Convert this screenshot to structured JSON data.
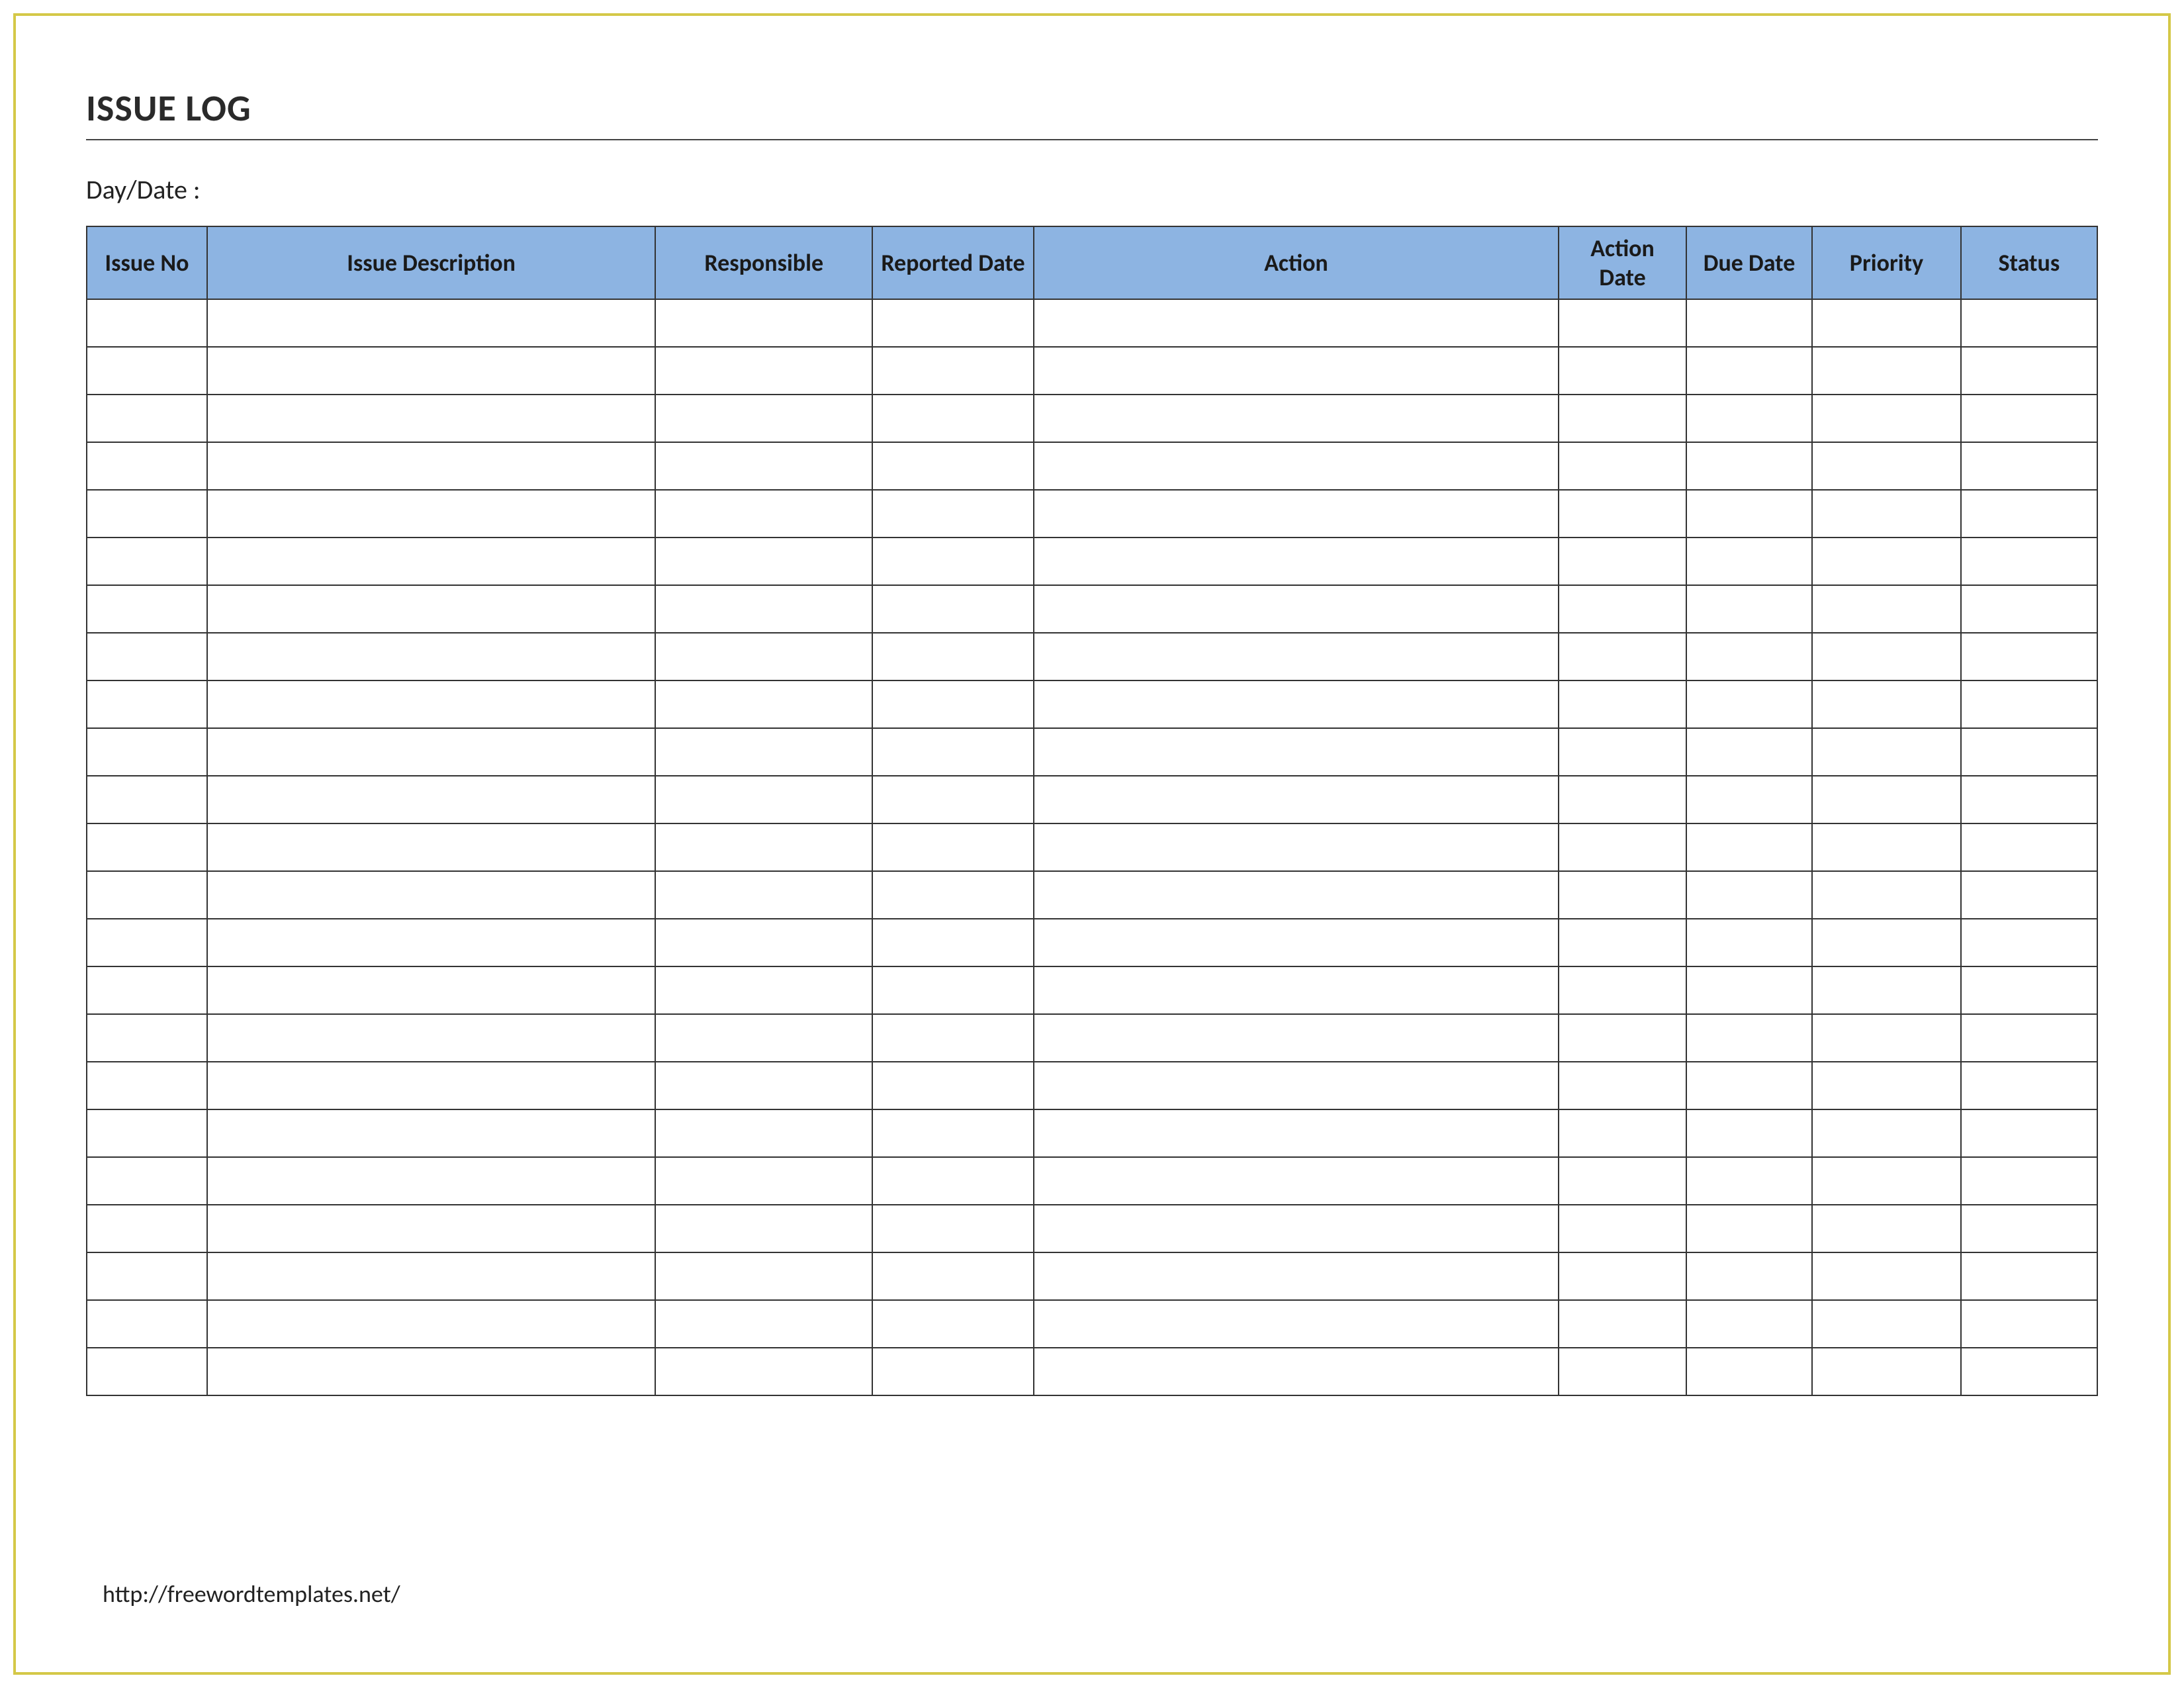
{
  "title": "ISSUE LOG",
  "day_date_label": "Day/Date :",
  "columns": {
    "issue_no": "Issue No",
    "description": "Issue Description",
    "responsible": "Responsible",
    "reported_date": "Reported Date",
    "action": "Action",
    "action_date": "Action Date",
    "due_date": "Due Date",
    "priority": "Priority",
    "status": "Status"
  },
  "rows": [
    {
      "issue_no": "",
      "description": "",
      "responsible": "",
      "reported_date": "",
      "action": "",
      "action_date": "",
      "due_date": "",
      "priority": "",
      "status": ""
    },
    {
      "issue_no": "",
      "description": "",
      "responsible": "",
      "reported_date": "",
      "action": "",
      "action_date": "",
      "due_date": "",
      "priority": "",
      "status": ""
    },
    {
      "issue_no": "",
      "description": "",
      "responsible": "",
      "reported_date": "",
      "action": "",
      "action_date": "",
      "due_date": "",
      "priority": "",
      "status": ""
    },
    {
      "issue_no": "",
      "description": "",
      "responsible": "",
      "reported_date": "",
      "action": "",
      "action_date": "",
      "due_date": "",
      "priority": "",
      "status": ""
    },
    {
      "issue_no": "",
      "description": "",
      "responsible": "",
      "reported_date": "",
      "action": "",
      "action_date": "",
      "due_date": "",
      "priority": "",
      "status": ""
    },
    {
      "issue_no": "",
      "description": "",
      "responsible": "",
      "reported_date": "",
      "action": "",
      "action_date": "",
      "due_date": "",
      "priority": "",
      "status": ""
    },
    {
      "issue_no": "",
      "description": "",
      "responsible": "",
      "reported_date": "",
      "action": "",
      "action_date": "",
      "due_date": "",
      "priority": "",
      "status": ""
    },
    {
      "issue_no": "",
      "description": "",
      "responsible": "",
      "reported_date": "",
      "action": "",
      "action_date": "",
      "due_date": "",
      "priority": "",
      "status": ""
    },
    {
      "issue_no": "",
      "description": "",
      "responsible": "",
      "reported_date": "",
      "action": "",
      "action_date": "",
      "due_date": "",
      "priority": "",
      "status": ""
    },
    {
      "issue_no": "",
      "description": "",
      "responsible": "",
      "reported_date": "",
      "action": "",
      "action_date": "",
      "due_date": "",
      "priority": "",
      "status": ""
    },
    {
      "issue_no": "",
      "description": "",
      "responsible": "",
      "reported_date": "",
      "action": "",
      "action_date": "",
      "due_date": "",
      "priority": "",
      "status": ""
    },
    {
      "issue_no": "",
      "description": "",
      "responsible": "",
      "reported_date": "",
      "action": "",
      "action_date": "",
      "due_date": "",
      "priority": "",
      "status": ""
    },
    {
      "issue_no": "",
      "description": "",
      "responsible": "",
      "reported_date": "",
      "action": "",
      "action_date": "",
      "due_date": "",
      "priority": "",
      "status": ""
    },
    {
      "issue_no": "",
      "description": "",
      "responsible": "",
      "reported_date": "",
      "action": "",
      "action_date": "",
      "due_date": "",
      "priority": "",
      "status": ""
    },
    {
      "issue_no": "",
      "description": "",
      "responsible": "",
      "reported_date": "",
      "action": "",
      "action_date": "",
      "due_date": "",
      "priority": "",
      "status": ""
    },
    {
      "issue_no": "",
      "description": "",
      "responsible": "",
      "reported_date": "",
      "action": "",
      "action_date": "",
      "due_date": "",
      "priority": "",
      "status": ""
    },
    {
      "issue_no": "",
      "description": "",
      "responsible": "",
      "reported_date": "",
      "action": "",
      "action_date": "",
      "due_date": "",
      "priority": "",
      "status": ""
    },
    {
      "issue_no": "",
      "description": "",
      "responsible": "",
      "reported_date": "",
      "action": "",
      "action_date": "",
      "due_date": "",
      "priority": "",
      "status": ""
    },
    {
      "issue_no": "",
      "description": "",
      "responsible": "",
      "reported_date": "",
      "action": "",
      "action_date": "",
      "due_date": "",
      "priority": "",
      "status": ""
    },
    {
      "issue_no": "",
      "description": "",
      "responsible": "",
      "reported_date": "",
      "action": "",
      "action_date": "",
      "due_date": "",
      "priority": "",
      "status": ""
    },
    {
      "issue_no": "",
      "description": "",
      "responsible": "",
      "reported_date": "",
      "action": "",
      "action_date": "",
      "due_date": "",
      "priority": "",
      "status": ""
    },
    {
      "issue_no": "",
      "description": "",
      "responsible": "",
      "reported_date": "",
      "action": "",
      "action_date": "",
      "due_date": "",
      "priority": "",
      "status": ""
    },
    {
      "issue_no": "",
      "description": "",
      "responsible": "",
      "reported_date": "",
      "action": "",
      "action_date": "",
      "due_date": "",
      "priority": "",
      "status": ""
    }
  ],
  "footer_url": "http://freewordtemplates.net/"
}
